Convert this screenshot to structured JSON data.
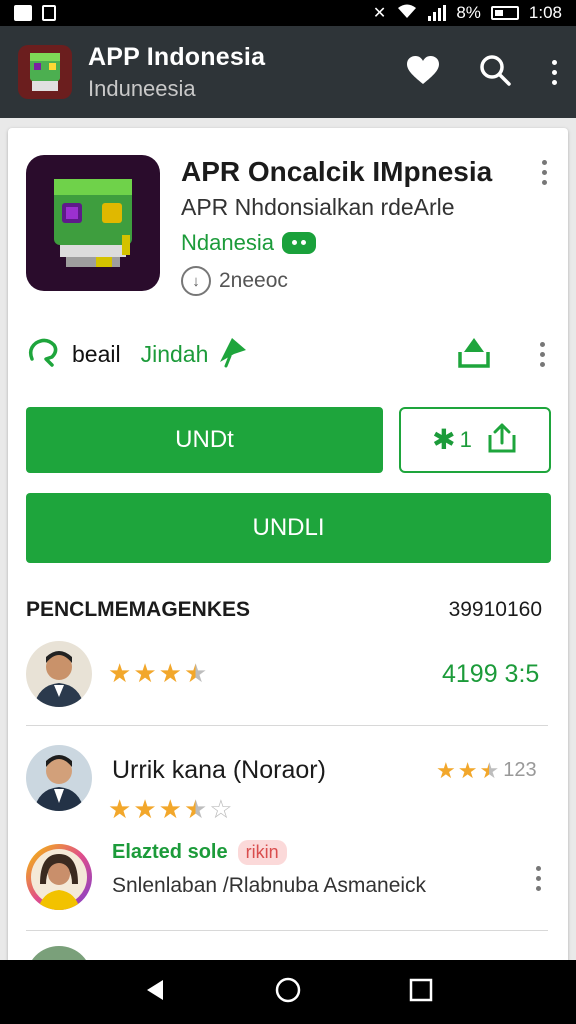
{
  "status_bar": {
    "battery": "8%",
    "time": "1:08"
  },
  "app_bar": {
    "title": "APP Indonesia",
    "subtitle": "Induneesia",
    "actions": [
      "favorite",
      "search",
      "more"
    ]
  },
  "app": {
    "title": "APR Oncalcik IMpnesia",
    "developer": "APR Nhdonsialkan rdeArle",
    "category": "Ndanesia",
    "downloads": "2neeoc",
    "tag_beail": "beail",
    "tag_jindah": "Jindah"
  },
  "buttons": {
    "primary": "UNDt",
    "rating_count": "1",
    "wide": "UNDLI"
  },
  "reviews": {
    "header": "PENCLMEMAGENKES",
    "header_count": "39910160",
    "items": [
      {
        "rating": 3.5,
        "score": "4199 3:5"
      },
      {
        "name": "Urrik kana (Noraor)",
        "rating": 3.5,
        "side_rating": 2.5,
        "side_count": "123"
      },
      {
        "badge_green": "Elazted sole",
        "badge_pink": "rikin",
        "text": "Snlenlaban /Rlabnuba Asmaneick"
      }
    ]
  },
  "colors": {
    "accent": "#1ea53c",
    "appbar": "#2e3438",
    "star": "#f2a72b"
  },
  "icons": {
    "appbar": [
      "heart-icon",
      "search-icon",
      "more-icon"
    ],
    "nav": [
      "back-icon",
      "home-icon",
      "recents-icon"
    ]
  }
}
